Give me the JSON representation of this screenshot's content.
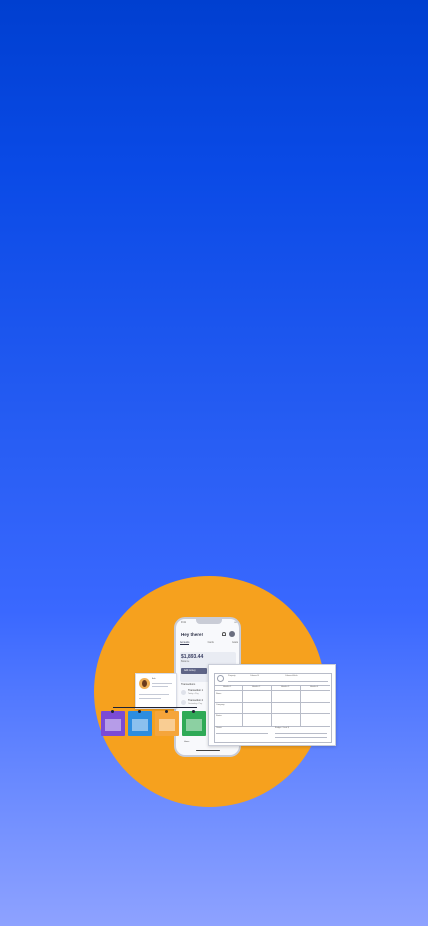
{
  "phone": {
    "status_time": "9:41",
    "status_icons": "•••",
    "greeting": "Hey there!",
    "tabs": [
      "Accounts",
      "Cards",
      "Goals"
    ],
    "balance": "$1,893.44",
    "balance_sub": "Balance",
    "add_button": "Add money",
    "transactions_heading": "Transactions",
    "transactions": [
      {
        "title": "Transaction 1",
        "sub": "Today • Pay"
      },
      {
        "title": "Transaction 2",
        "sub": "Yesterday • Pay"
      }
    ],
    "nav_home": "Home"
  },
  "user_card": {
    "name": "Ada"
  },
  "color_cards": [
    {
      "color": "#7b4bd6"
    },
    {
      "color": "#2d8de0"
    },
    {
      "color": "#f5a53b"
    },
    {
      "color": "#2faa57"
    }
  ],
  "doc": {
    "header_cols": [
      "Property",
      "Column B",
      "Column A Info"
    ],
    "grid_cols": [
      "Header 1",
      "Header 2",
      "Header 3",
      "Header 4"
    ],
    "row_labels": [
      "Name",
      "Company",
      "Status"
    ],
    "footer_left": "Owner",
    "footer_right": "Budget / Limit $"
  },
  "colors": {
    "background_top": "#003fd0",
    "background_bottom": "#8ea2ff",
    "circle": "#f6a11e"
  }
}
